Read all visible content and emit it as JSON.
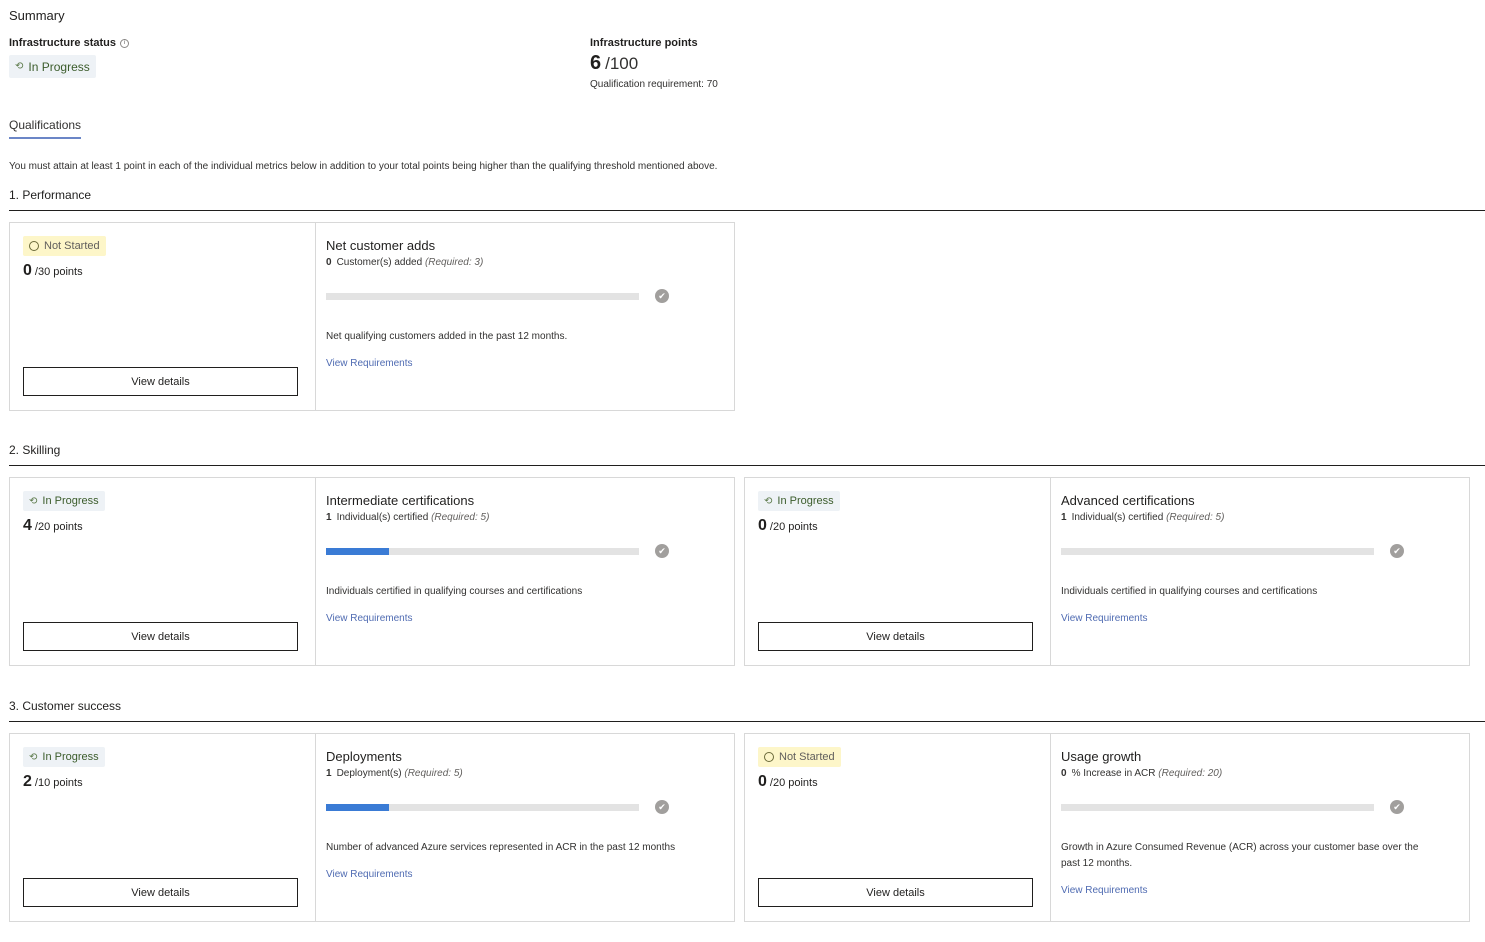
{
  "summary": {
    "title": "Summary",
    "status_label": "Infrastructure status",
    "status_value": "In Progress",
    "points_label": "Infrastructure points",
    "points_value": "6",
    "points_total": "/100",
    "qualification_requirement": "Qualification requirement: 70"
  },
  "tabs": {
    "qualifications": "Qualifications"
  },
  "intro": "You must attain at least 1 point in each of the individual metrics below in addition to your total points being higher than the qualifying threshold mentioned above.",
  "common": {
    "view_details": "View details",
    "view_requirements": "View Requirements"
  },
  "sections": [
    {
      "title": "1. Performance",
      "cards": [
        {
          "status": "Not Started",
          "status_type": "notstarted",
          "points": "0",
          "points_of": "/30 points",
          "metric_title": "Net customer adds",
          "count": "0",
          "unit": "Customer(s) added",
          "required": "(Required: 3)",
          "progress": 0,
          "description": "Net qualifying customers added in the past 12 months."
        }
      ]
    },
    {
      "title": "2. Skilling",
      "cards": [
        {
          "status": "In Progress",
          "status_type": "progress",
          "points": "4",
          "points_of": "/20 points",
          "metric_title": "Intermediate certifications",
          "count": "1",
          "unit": "Individual(s) certified",
          "required": "(Required: 5)",
          "progress": 0.2,
          "description": "Individuals certified in qualifying courses and certifications"
        },
        {
          "status": "In Progress",
          "status_type": "progress",
          "points": "0",
          "points_of": "/20 points",
          "metric_title": "Advanced certifications",
          "count": "1",
          "unit": "Individual(s) certified",
          "required": "(Required: 5)",
          "progress": 0,
          "description": "Individuals certified in qualifying courses and certifications"
        }
      ]
    },
    {
      "title": "3. Customer success",
      "cards": [
        {
          "status": "In Progress",
          "status_type": "progress",
          "points": "2",
          "points_of": "/10 points",
          "metric_title": "Deployments",
          "count": "1",
          "unit": "Deployment(s)",
          "required": "(Required: 5)",
          "progress": 0.2,
          "description": "Number of advanced Azure services represented in ACR in the past 12 months"
        },
        {
          "status": "Not Started",
          "status_type": "notstarted",
          "points": "0",
          "points_of": "/20 points",
          "metric_title": "Usage growth",
          "count": "0",
          "unit": "% Increase in ACR",
          "required": "(Required: 20)",
          "progress": 0,
          "description": "Growth in Azure Consumed Revenue (ACR) across your customer base over the past 12 months."
        }
      ]
    }
  ]
}
